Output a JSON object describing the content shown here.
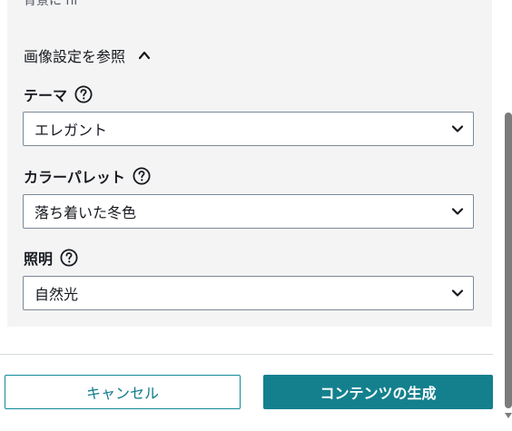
{
  "top_cut_text": "背景に hi",
  "section": {
    "toggle_label": "画像設定を参照"
  },
  "fields": {
    "theme": {
      "label": "テーマ",
      "value": "エレガント"
    },
    "palette": {
      "label": "カラーパレット",
      "value": "落ち着いた冬色"
    },
    "lighting": {
      "label": "照明",
      "value": "自然光"
    }
  },
  "buttons": {
    "cancel_label": "キャンセル",
    "generate_label": "コンテンツの生成"
  },
  "colors": {
    "primary": "#14808e",
    "panel_background": "#f4f4f4",
    "border": "#7d8998"
  },
  "icons": {
    "help": "help-circle-icon",
    "expand": "chevron-up-icon",
    "dropdown": "chevron-down-icon"
  }
}
